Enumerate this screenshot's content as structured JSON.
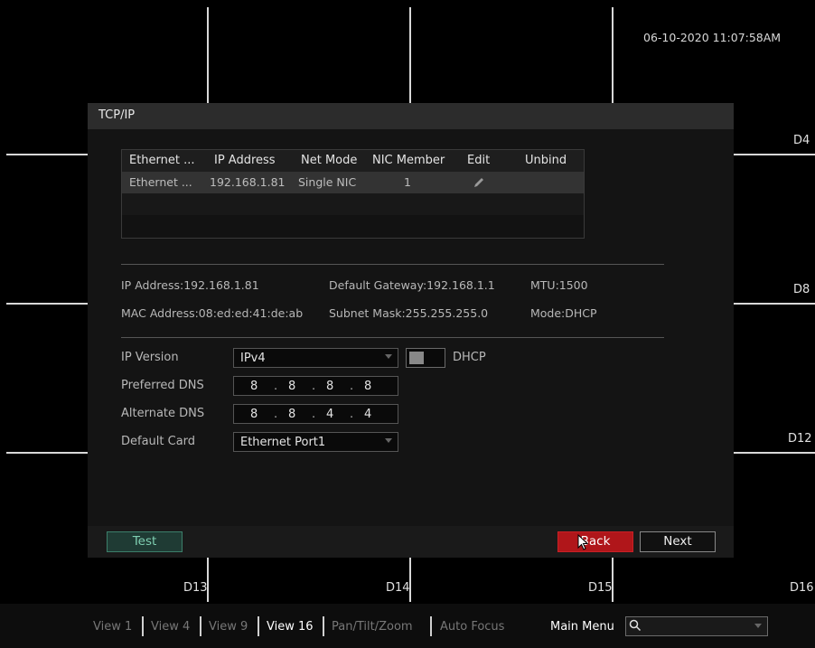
{
  "timestamp": "06-10-2020 11:07:58AM",
  "channels": {
    "d4": "D4",
    "d8": "D8",
    "d12": "D12",
    "d13": "D13",
    "d14": "D14",
    "d15": "D15",
    "d16": "D16"
  },
  "dialog": {
    "title": "TCP/IP",
    "table": {
      "headers": [
        "Ethernet ...",
        "IP Address",
        "Net Mode",
        "NIC Member",
        "Edit",
        "Unbind"
      ],
      "rows": [
        {
          "ethernet": "Ethernet ...",
          "ip": "192.168.1.81",
          "mode": "Single NIC",
          "member": "1",
          "edit_icon": "pencil-icon",
          "unbind": ""
        }
      ]
    },
    "info": {
      "ip_address": "IP Address:192.168.1.81",
      "gateway": "Default Gateway:192.168.1.1",
      "mtu": "MTU:1500",
      "mac": "MAC Address:08:ed:ed:41:de:ab",
      "subnet": "Subnet Mask:255.255.255.0",
      "mode": "Mode:DHCP"
    },
    "form": {
      "ip_version_label": "IP Version",
      "ip_version_value": "IPv4",
      "dhcp_label": "DHCP",
      "dhcp_enabled": false,
      "preferred_dns_label": "Preferred DNS",
      "preferred_dns": [
        "8",
        "8",
        "8",
        "8"
      ],
      "alternate_dns_label": "Alternate DNS",
      "alternate_dns": [
        "8",
        "8",
        "4",
        "4"
      ],
      "default_card_label": "Default Card",
      "default_card_value": "Ethernet Port1",
      "ip_dot": "."
    },
    "buttons": {
      "test": "Test",
      "back": "Back",
      "next": "Next"
    }
  },
  "bottom_bar": {
    "view1": "View 1",
    "view4": "View 4",
    "view9": "View 9",
    "view16": "View 16",
    "ptz": "Pan/Tilt/Zoom",
    "autofocus": "Auto Focus",
    "main_menu": "Main Menu",
    "active": "View 16",
    "search_icon": "search-icon"
  },
  "colors": {
    "back_button": "#b0161a",
    "test_button": "#1f3b34",
    "background": "#000000"
  }
}
